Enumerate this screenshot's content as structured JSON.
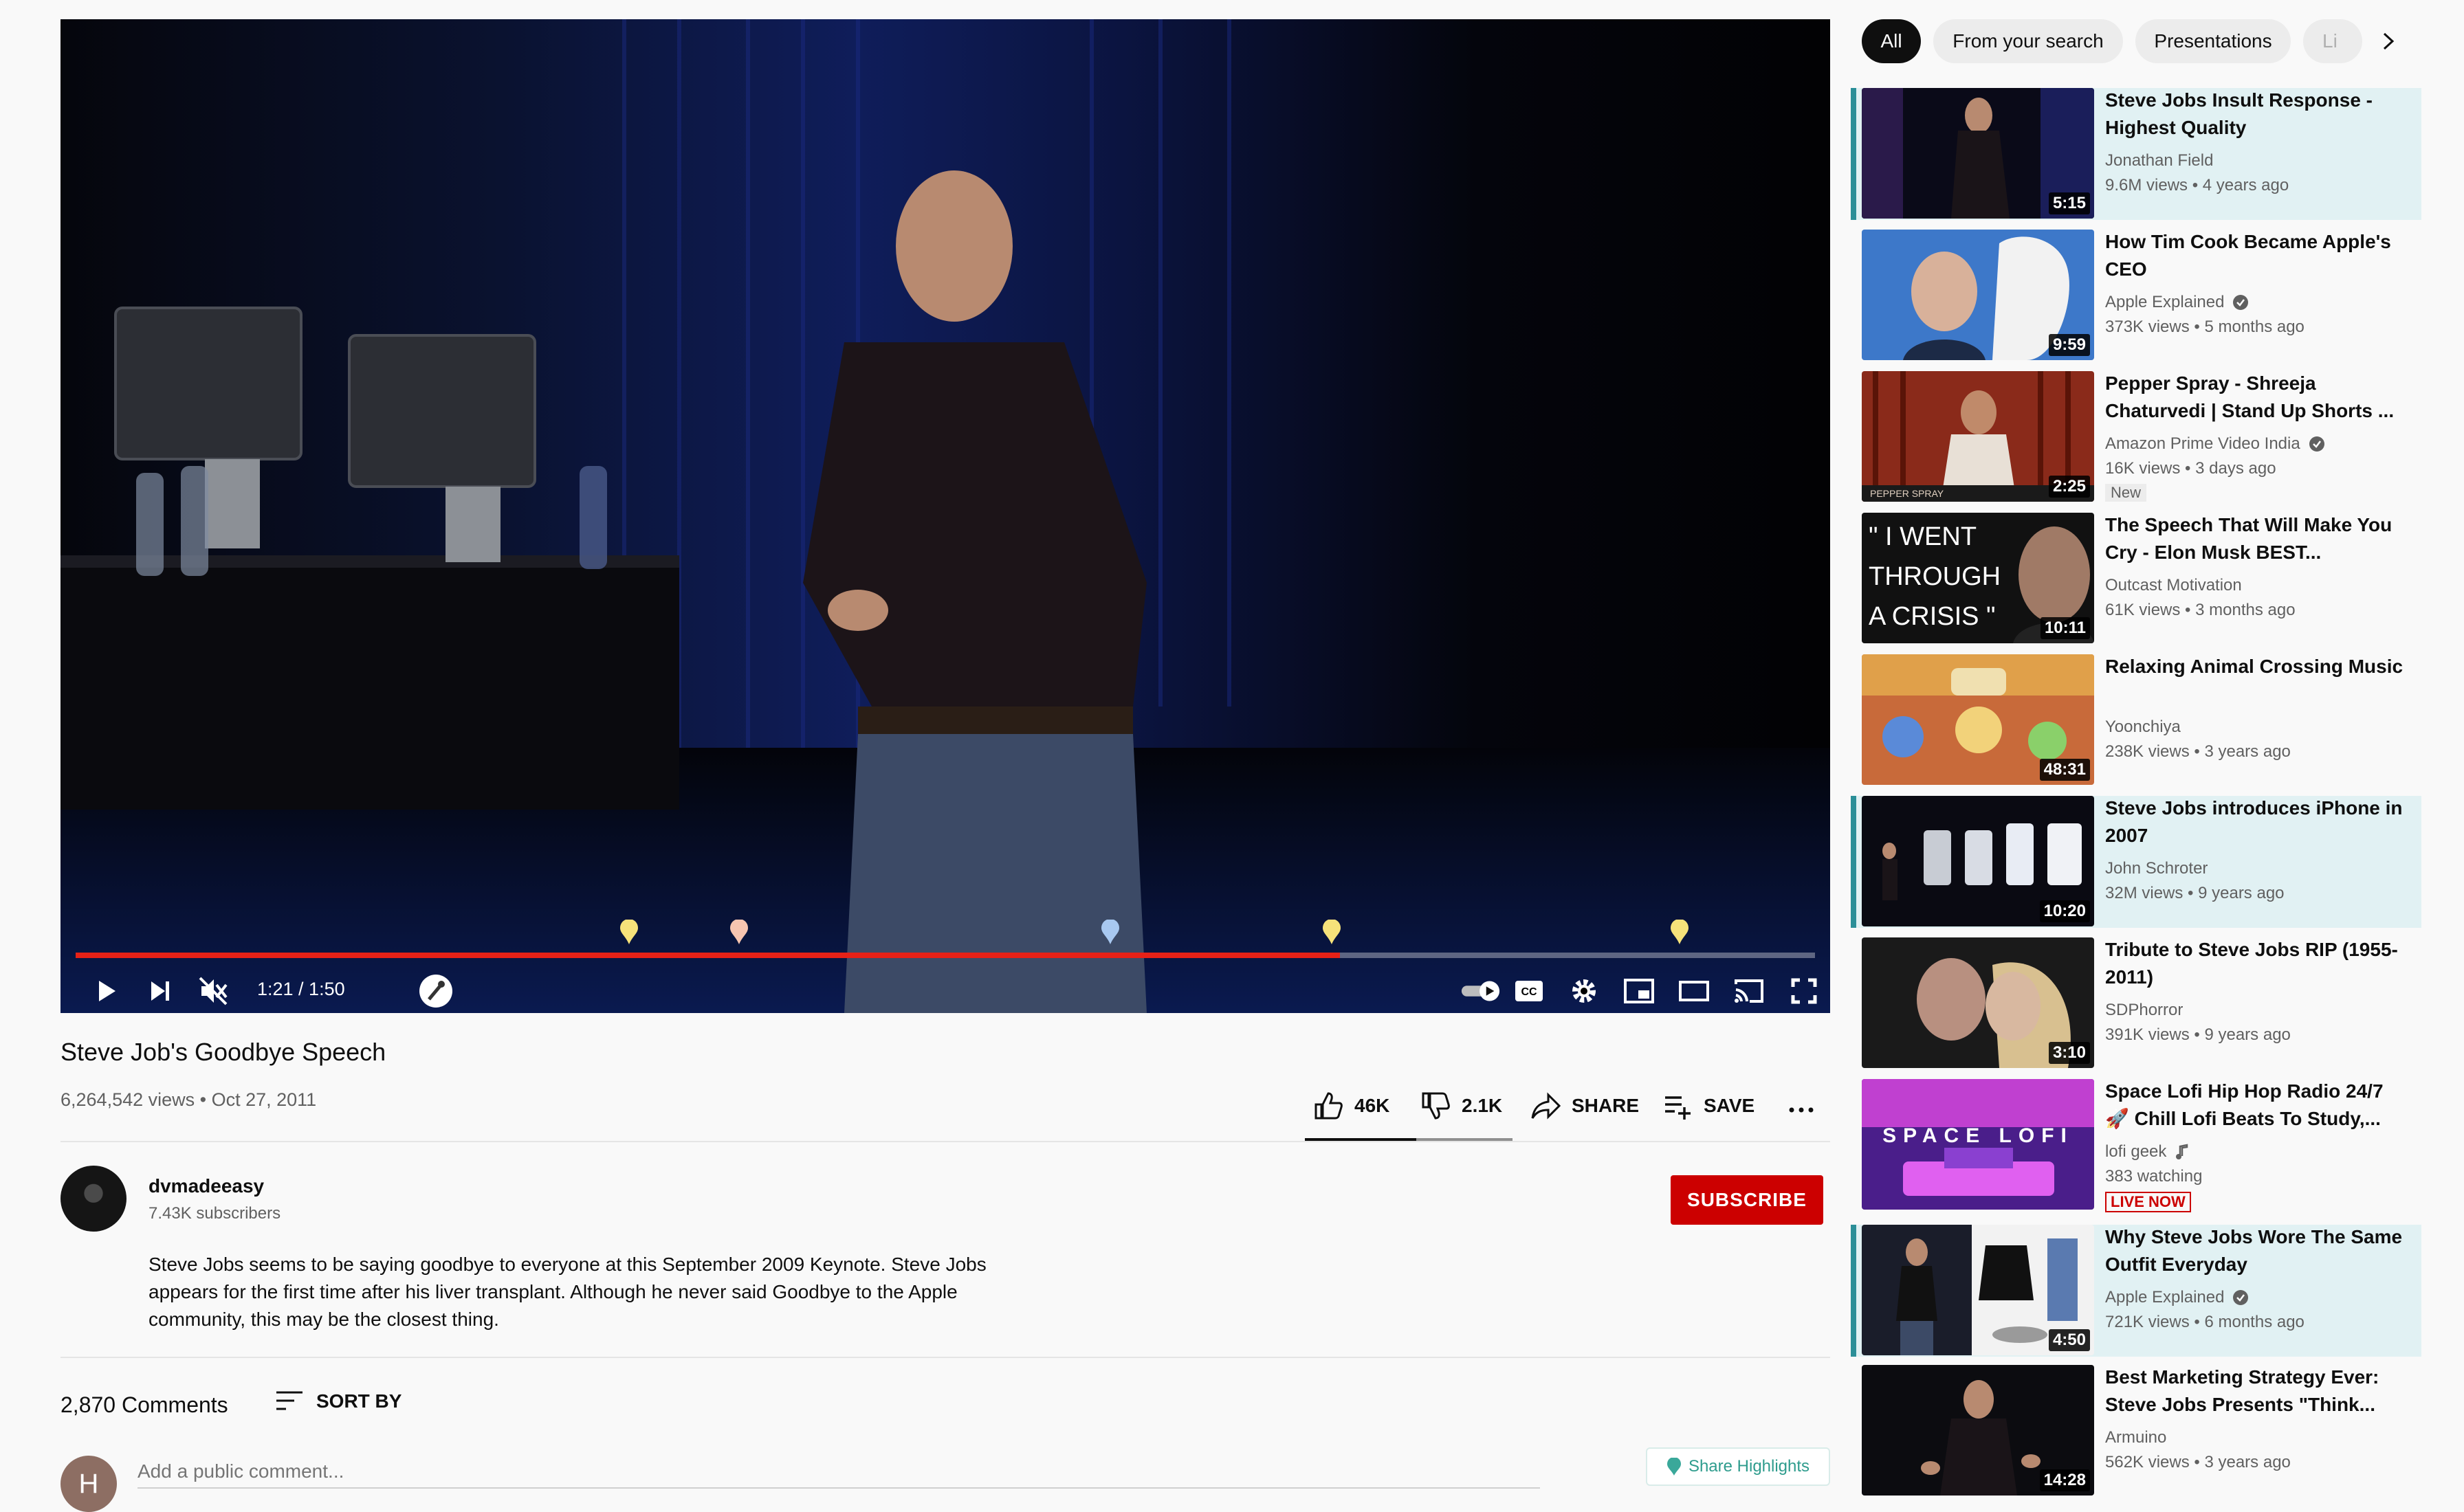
{
  "player": {
    "time": "1:21 / 1:50",
    "progress": 0.727
  },
  "video": {
    "title": "Steve Job's Goodbye Speech",
    "stats": "6,264,542 views • Oct 27, 2011"
  },
  "actions": {
    "like": "46K",
    "dislike": "2.1K",
    "share": "SHARE",
    "save": "SAVE"
  },
  "channel": {
    "name": "dvmadeeasy",
    "subscribers": "7.43K subscribers",
    "subscribe_label": "SUBSCRIBE"
  },
  "description": "Steve Jobs seems to be saying goodbye to everyone at this September 2009 Keynote.  Steve Jobs appears for the first time after his liver transplant.  Although he never said Goodbye to the Apple community, this may be the closest thing.",
  "comments": {
    "count": "2,870 Comments",
    "sort_label": "SORT BY",
    "user_initial": "H",
    "placeholder": "Add a public comment...",
    "share_highlights": "Share Highlights"
  },
  "chips": [
    "All",
    "From your search",
    "Presentations",
    "Li"
  ],
  "recommendations": [
    {
      "title": "Steve Jobs Insult Response - Highest Quality",
      "channel": "Jonathan Field",
      "meta": "9.6M views • 4 years ago",
      "duration": "5:15",
      "highlighted": true
    },
    {
      "title": "How Tim Cook Became Apple's CEO",
      "channel": "Apple Explained",
      "verified": true,
      "meta": "373K views • 5 months ago",
      "duration": "9:59"
    },
    {
      "title": "Pepper Spray - Shreeja Chaturvedi | Stand Up Shorts ...",
      "channel": "Amazon Prime Video India",
      "verified": true,
      "meta": "16K views • 3 days ago",
      "duration": "2:25",
      "badge": "New"
    },
    {
      "title": "The Speech That Will Make You Cry - Elon Musk BEST...",
      "channel": "Outcast Motivation",
      "meta": "61K views • 3 months ago",
      "duration": "10:11"
    },
    {
      "title": "Relaxing Animal Crossing Music",
      "channel": "Yoonchiya",
      "meta": "238K views • 3 years ago",
      "duration": "48:31"
    },
    {
      "title": "Steve Jobs introduces iPhone in 2007",
      "channel": "John Schroter",
      "meta": "32M views • 9 years ago",
      "duration": "10:20",
      "highlighted": true
    },
    {
      "title": "Tribute to Steve Jobs RIP (1955-2011)",
      "channel": "SDPhorror",
      "meta": "391K views • 9 years ago",
      "duration": "3:10"
    },
    {
      "title": "Space Lofi Hip Hop Radio 24/7 🚀 Chill Lofi Beats To Study,...",
      "channel": "lofi geek",
      "music": true,
      "meta": "383 watching",
      "live": "LIVE NOW"
    },
    {
      "title": "Why Steve Jobs Wore The Same Outfit Everyday",
      "channel": "Apple Explained",
      "verified": true,
      "meta": "721K views • 6 months ago",
      "duration": "4:50",
      "highlighted": true
    },
    {
      "title": "Best Marketing Strategy Ever: Steve Jobs Presents \"Think...",
      "channel": "Armuino",
      "meta": "562K views • 3 years ago",
      "duration": "14:28"
    }
  ],
  "thumb_texts": {
    "pepper": "PEPPER SPRAY",
    "elon": "\" I WENT THROUGH A CRISIS \"",
    "lofi": "SPACE LOFI"
  }
}
